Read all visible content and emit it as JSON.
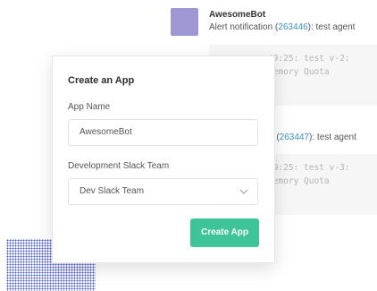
{
  "feed": {
    "bot_name": "AwesomeBot",
    "alert_1": {
      "prefix": "Alert notification (",
      "id": "263446",
      "suffix": "): test agent"
    },
    "code_1": "49:25: test v-2:\nMemory Quota",
    "alert_2": {
      "prefix": "a (",
      "id": "263447",
      "suffix": "): test agent"
    },
    "code_2": "49:25: test v-3:\nMemory Quota"
  },
  "modal": {
    "title": "Create an App",
    "app_name_label": "App Name",
    "app_name_value": "AwesomeBot",
    "team_label": "Development Slack Team",
    "team_selected": "Dev Slack Team",
    "submit_label": "Create App"
  },
  "colors": {
    "avatar": "#9f96d4",
    "link": "#3b8fbf",
    "primary_button": "#3fc49a",
    "dots": "#3d4fc4"
  },
  "icons": {
    "select": "chevron-down-icon"
  }
}
